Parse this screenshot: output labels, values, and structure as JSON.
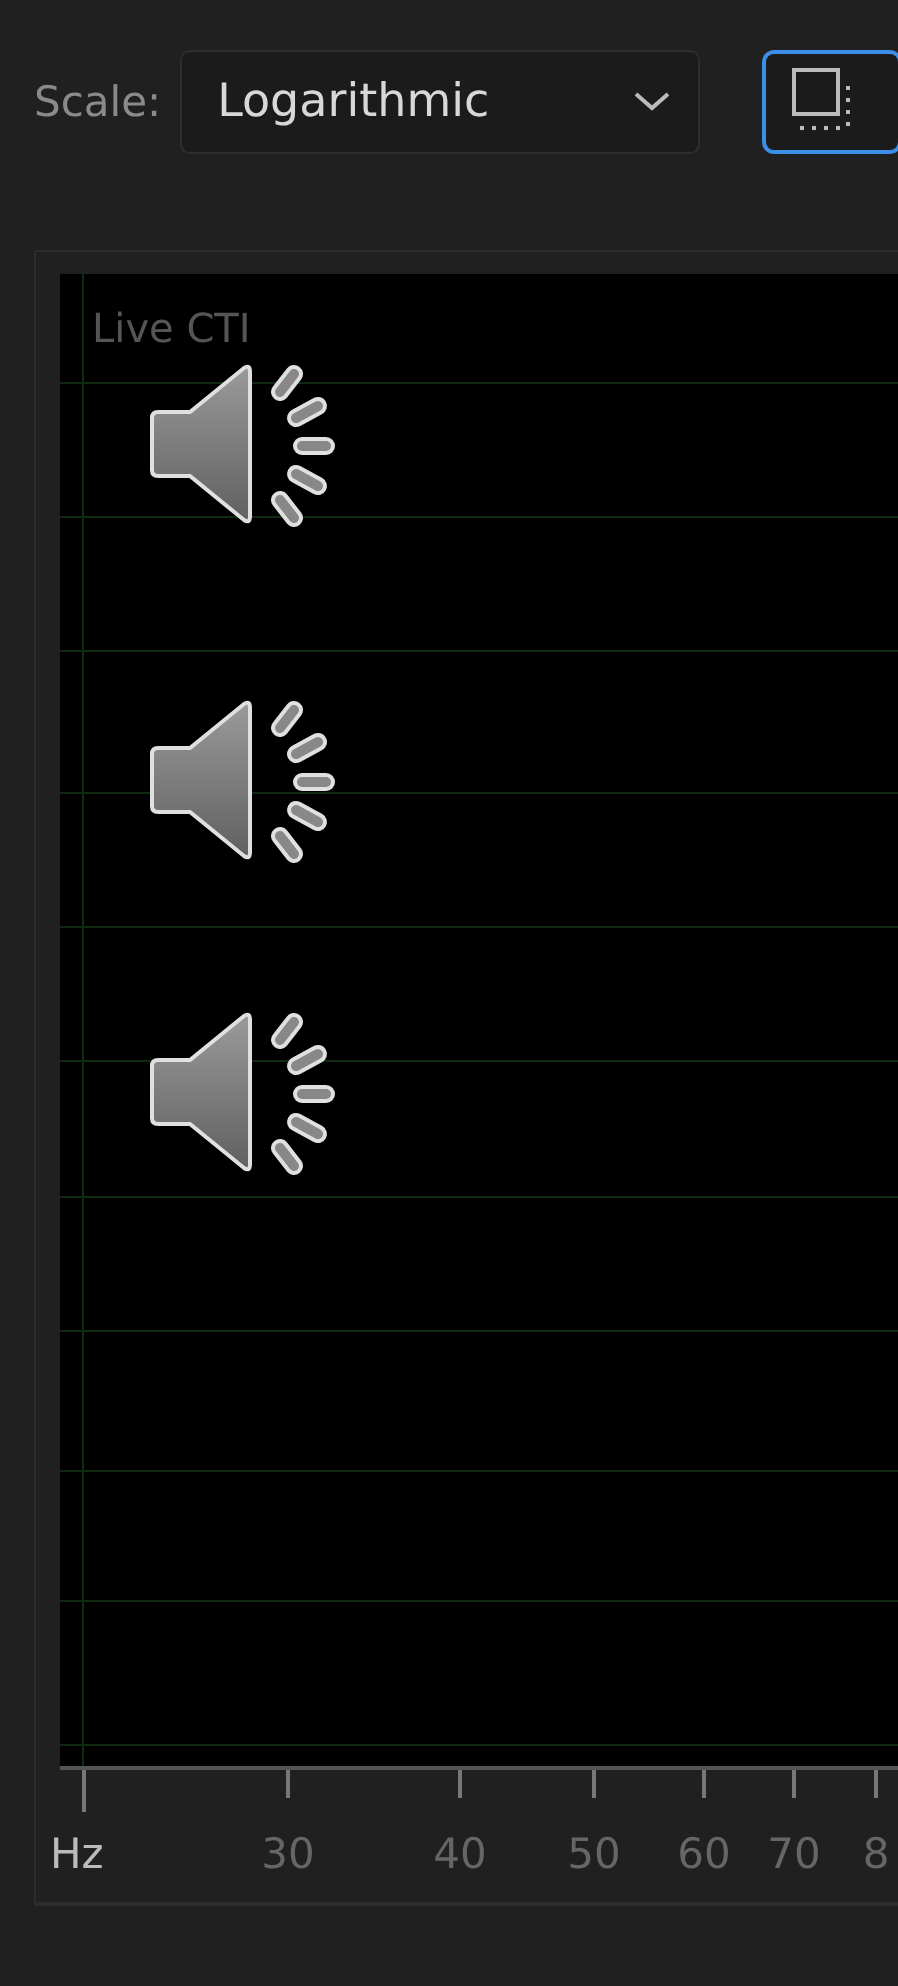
{
  "toolbar": {
    "scale_label": "Scale:",
    "scale_dropdown": {
      "value": "Logarithmic"
    },
    "view_button": {
      "selected": true
    }
  },
  "plot": {
    "overlay_label": "Live CTI",
    "overlays": [
      {
        "kind": "speaker"
      },
      {
        "kind": "speaker"
      },
      {
        "kind": "speaker"
      }
    ],
    "x_axis": {
      "unit": "Hz",
      "tick_labels": [
        "30",
        "40",
        "50",
        "60",
        "70",
        "8"
      ]
    }
  }
}
